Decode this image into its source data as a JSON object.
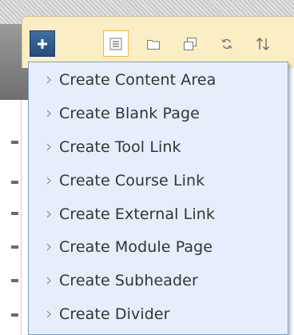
{
  "toolbar": {
    "add_menu_icon": "plus-icon",
    "icons": [
      "outline-icon",
      "folder-icon",
      "window-icon",
      "refresh-icon",
      "sort-icon"
    ]
  },
  "menu": {
    "items": [
      {
        "label": "Create Content Area"
      },
      {
        "label": "Create Blank Page"
      },
      {
        "label": "Create Tool Link"
      },
      {
        "label": "Create Course Link"
      },
      {
        "label": "Create External Link"
      },
      {
        "label": "Create Module Page"
      },
      {
        "label": "Create Subheader"
      },
      {
        "label": "Create Divider"
      }
    ]
  },
  "colors": {
    "toolbar_bg": "#fbeec4",
    "menu_bg": "#e6eefc",
    "menu_border": "#7e9fce",
    "plus_button": "#2f5a8e",
    "active_icon_border": "#f2b64a"
  }
}
